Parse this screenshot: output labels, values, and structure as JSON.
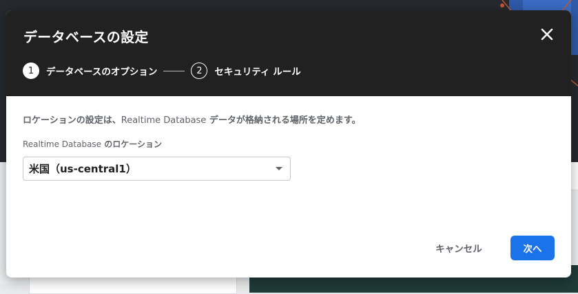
{
  "dialog": {
    "title": "データベースの設定",
    "close_icon": "close-icon"
  },
  "stepper": {
    "steps": [
      {
        "number": "1",
        "label": "データベースのオプション"
      },
      {
        "number": "2",
        "label": "セキュリティ ルール"
      }
    ]
  },
  "body": {
    "description_part1": "ロケーションの設定は、",
    "description_product": "Realtime Database",
    "description_part2": " データが格納される場所を定めます。",
    "field_label_product": "Realtime Database",
    "field_label_suffix": " のロケーション",
    "location_value": "米国（us-central1）",
    "dropdown_icon": "dropdown-arrow-icon"
  },
  "footer": {
    "cancel_label": "キャンセル",
    "next_label": "次へ"
  },
  "colors": {
    "header_bg": "#212121",
    "primary": "#1a73e8"
  }
}
